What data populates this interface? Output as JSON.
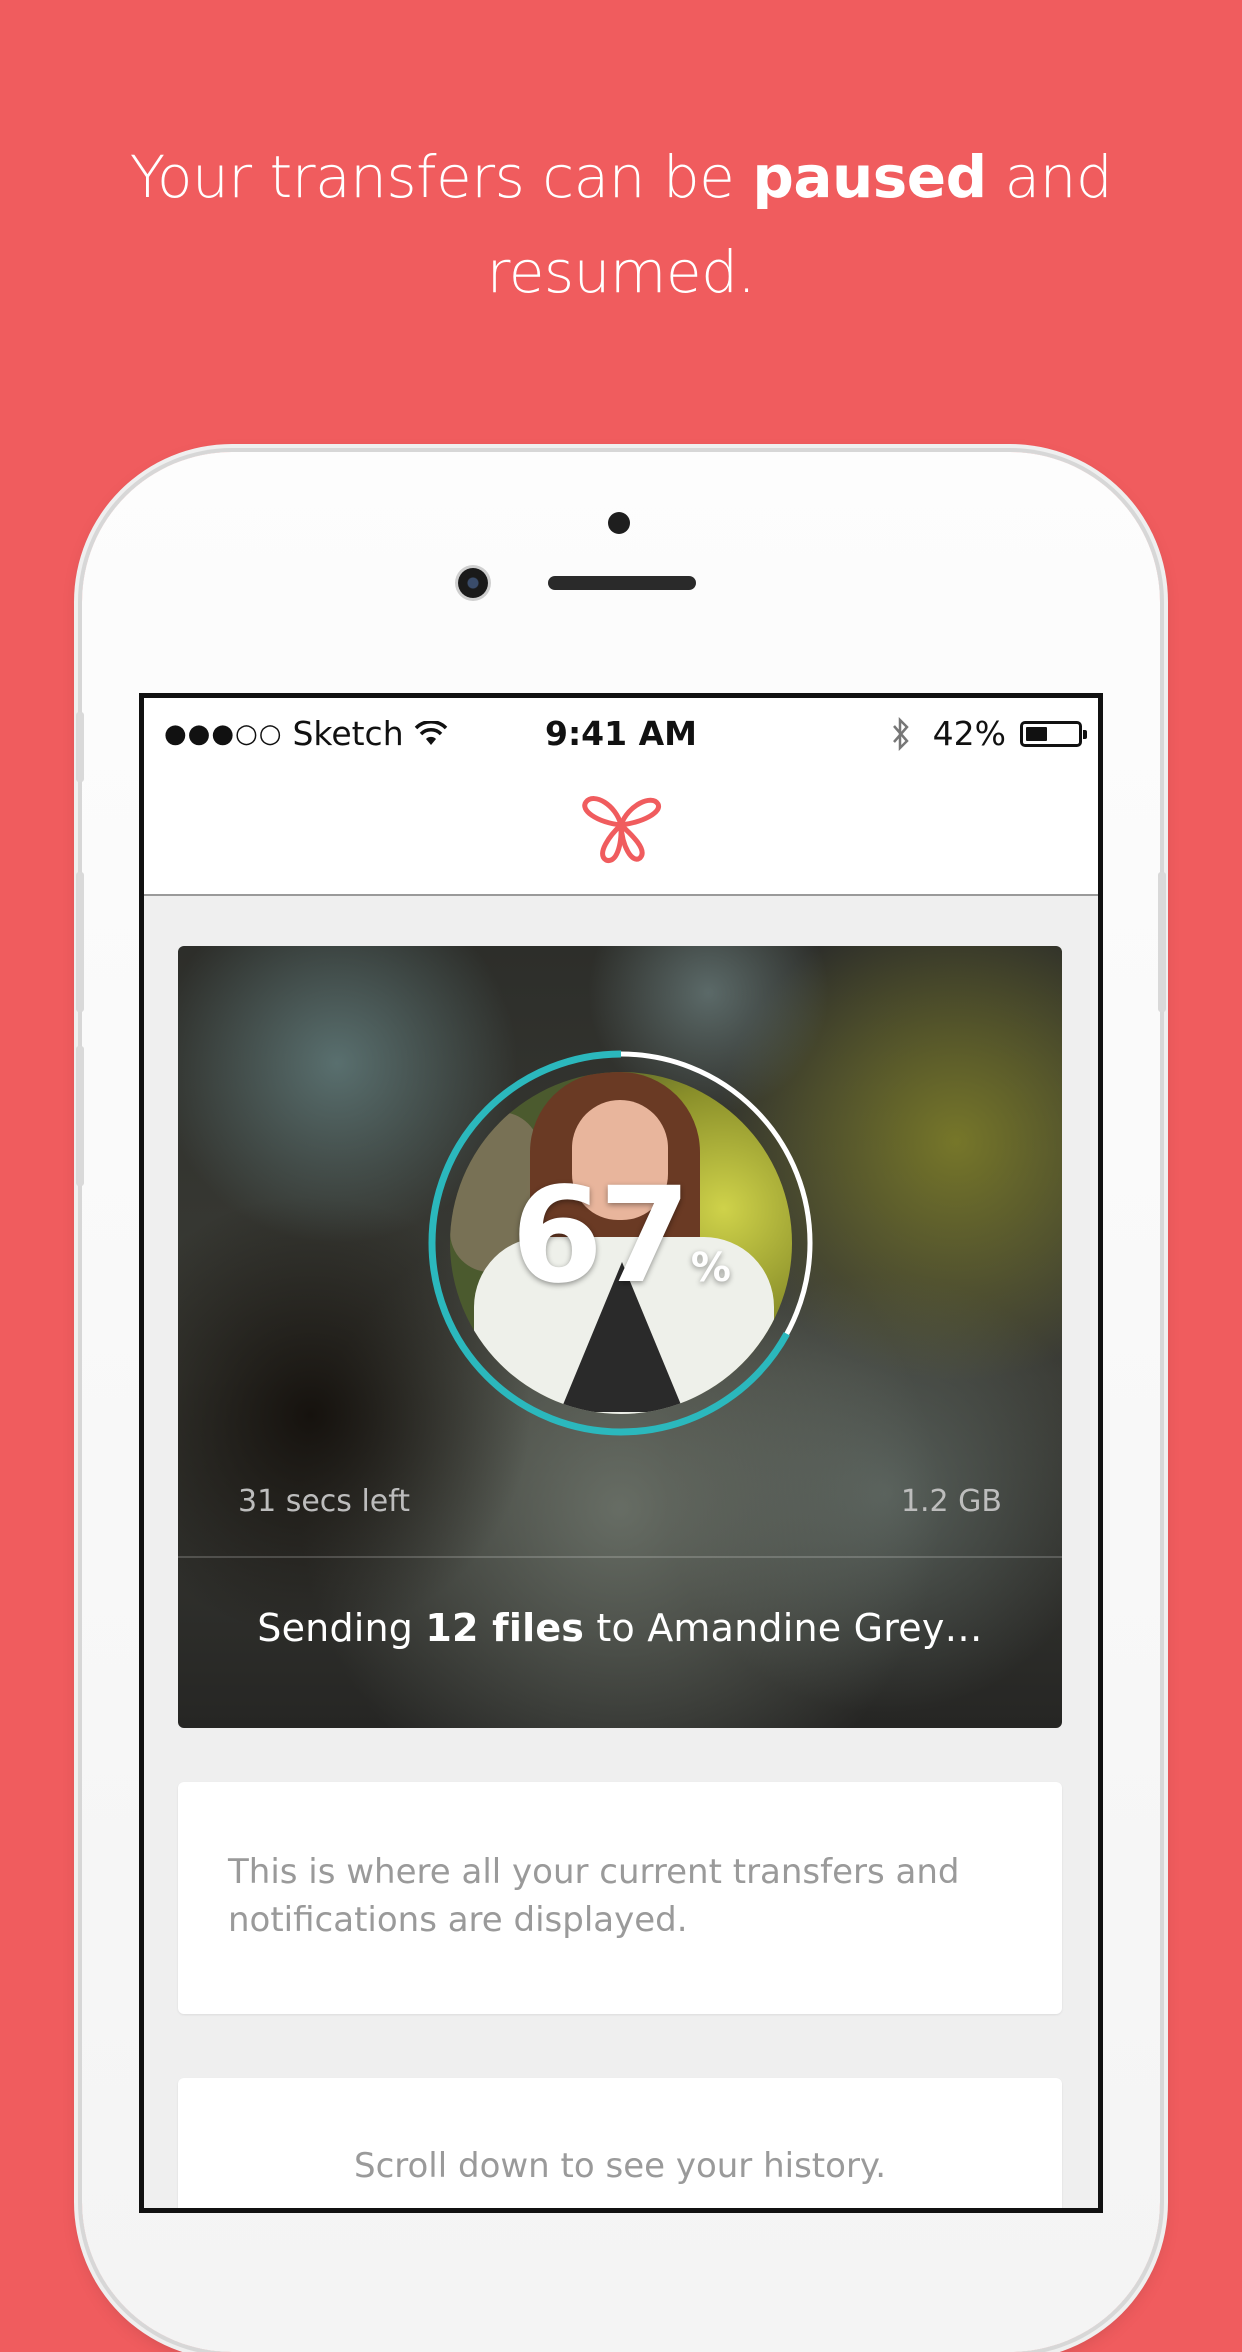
{
  "headline": {
    "part1": "Your transfers can be ",
    "bold": "paused",
    "part2": " and resumed."
  },
  "status_bar": {
    "signal": "●●●○○",
    "carrier": "Sketch",
    "time": "9:41 AM",
    "battery": "42%",
    "battery_level": 0.42
  },
  "transfer": {
    "progress_value": "67",
    "progress_unit": "%",
    "progress": 0.67,
    "time_left": "31 secs left",
    "size": "1.2 GB",
    "sending_prefix": "Sending ",
    "sending_bold": "12 files",
    "sending_suffix": " to Amandine Grey…",
    "accent_color": "#2bb8bd"
  },
  "info_card": {
    "text": "This is where all your current transfers and notifications are displayed."
  },
  "history_card": {
    "text": "Scroll down to see your history."
  },
  "colors": {
    "background": "#f05c5e",
    "brand": "#f05c5e"
  }
}
